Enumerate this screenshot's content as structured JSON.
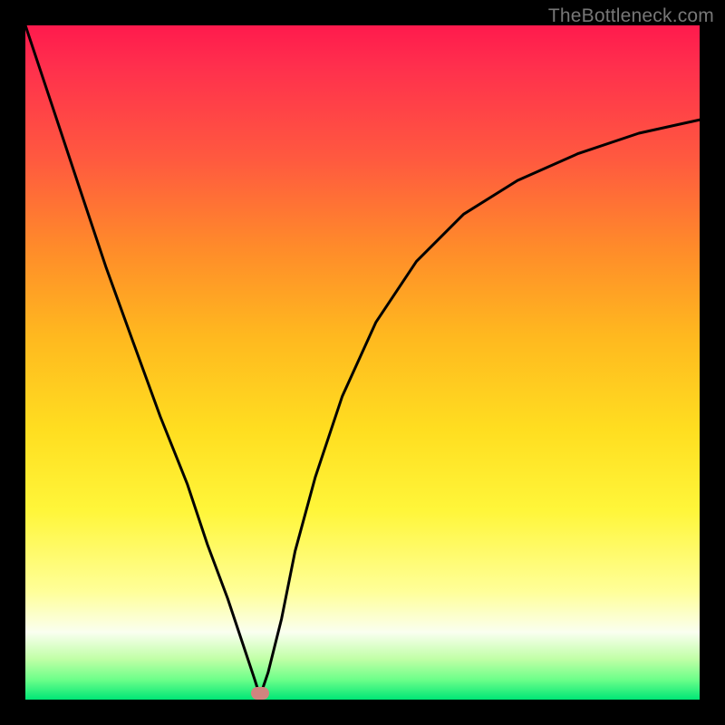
{
  "watermark": "TheBottleneck.com",
  "marker": {
    "x_pct": 34.8,
    "y_pct": 99.0
  },
  "colors": {
    "frame": "#000000",
    "curve": "#000000",
    "marker": "#cf847f",
    "gradient_top": "#ff1a4d",
    "gradient_bottom": "#00e676"
  },
  "chart_data": {
    "type": "line",
    "title": "",
    "xlabel": "",
    "ylabel": "",
    "xlim": [
      0,
      100
    ],
    "ylim": [
      0,
      100
    ],
    "grid": false,
    "legend": false,
    "annotations": [
      {
        "text": "TheBottleneck.com",
        "position": "top-right"
      }
    ],
    "background_gradient": {
      "direction": "vertical",
      "stops": [
        {
          "pct": 0,
          "color": "#ff1a4d"
        },
        {
          "pct": 20,
          "color": "#ff5a3f"
        },
        {
          "pct": 46,
          "color": "#ffde20"
        },
        {
          "pct": 84,
          "color": "#ffff99"
        },
        {
          "pct": 97,
          "color": "#6eff8a"
        },
        {
          "pct": 100,
          "color": "#00e676"
        }
      ]
    },
    "series": [
      {
        "name": "bottleneck-curve",
        "x": [
          0,
          4,
          8,
          12,
          16,
          20,
          24,
          27,
          30,
          32,
          34,
          34.8,
          36,
          38,
          40,
          43,
          47,
          52,
          58,
          65,
          73,
          82,
          91,
          100
        ],
        "y": [
          100,
          88,
          76,
          64,
          53,
          42,
          32,
          23,
          15,
          9,
          3,
          0.5,
          4,
          12,
          22,
          33,
          45,
          56,
          65,
          72,
          77,
          81,
          84,
          86
        ]
      }
    ],
    "marker_point": {
      "x": 34.8,
      "y": 0.5
    }
  }
}
